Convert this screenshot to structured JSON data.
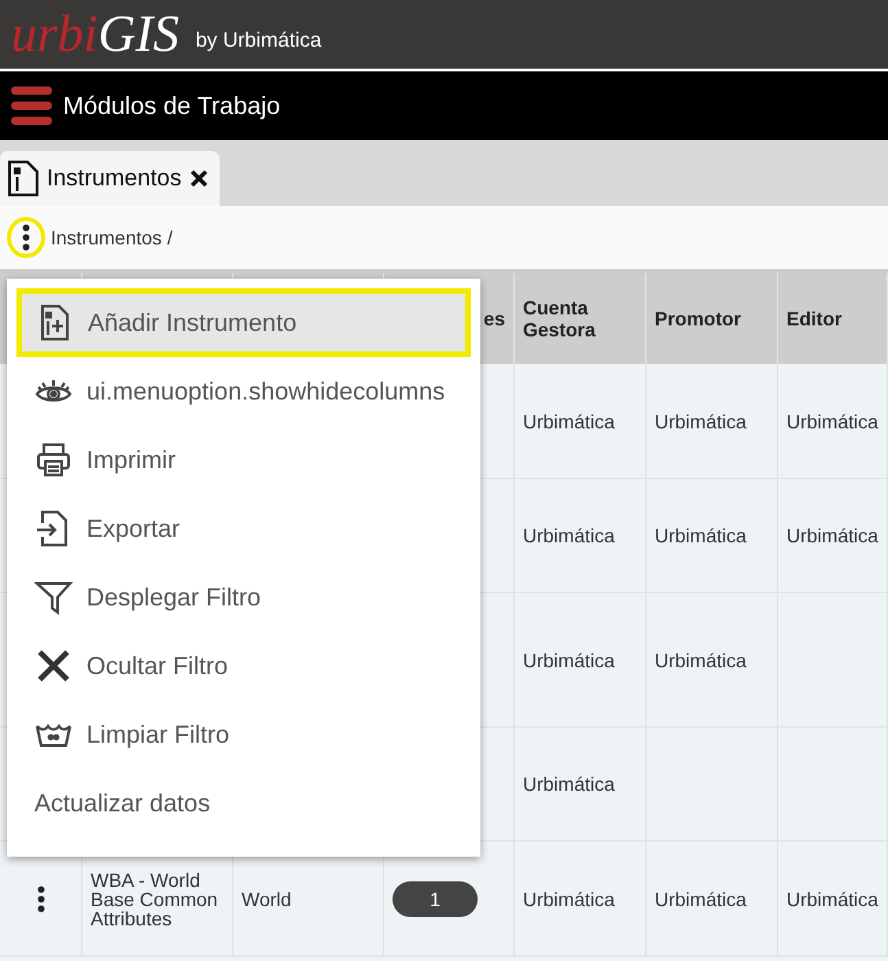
{
  "header": {
    "logo": [
      "urbi",
      "GIS"
    ],
    "byline": "by Urbimática"
  },
  "nav": {
    "title": "Módulos de Trabajo"
  },
  "tabs": [
    {
      "label": "Instrumentos",
      "selected": true
    }
  ],
  "breadcrumb": "Instrumentos /",
  "table": {
    "columns": [
      {},
      {},
      {},
      {
        "label": "es"
      },
      {
        "label": "Cuenta Gestora"
      },
      {
        "label": "Promotor"
      },
      {
        "label": "Editor"
      }
    ],
    "rows": [
      {
        "cuenta": "Urbimática",
        "promotor": "Urbimática",
        "editor": "Urbimática"
      },
      {
        "cuenta": "Urbimática",
        "promotor": "Urbimática",
        "editor": "Urbimática"
      },
      {
        "cuenta": "Urbimática",
        "promotor": "Urbimática"
      },
      {
        "cuenta": "Urbimática"
      },
      {
        "code": "WBA - World Base Common Attributes",
        "scope": "World",
        "count": "1",
        "cuenta": "Urbimática",
        "promotor": "Urbimática",
        "editor": "Urbimática"
      }
    ]
  },
  "menu": {
    "items": [
      {
        "kind": "add",
        "label": "Añadir Instrumento",
        "selected": true
      },
      {
        "kind": "eye",
        "label": "ui.menuoption.showhidecolumns",
        "selected": false
      },
      {
        "kind": "print",
        "label": "Imprimir",
        "selected": false
      },
      {
        "kind": "export",
        "label": "Exportar",
        "selected": false
      },
      {
        "kind": "filter",
        "label": "Desplegar Filtro",
        "selected": false
      },
      {
        "kind": "close",
        "label": "Ocultar Filtro",
        "selected": false
      },
      {
        "kind": "clear",
        "label": "Limpiar Filtro",
        "selected": false
      },
      {
        "kind": "none",
        "label": "Actualizar datos",
        "selected": false
      }
    ]
  }
}
